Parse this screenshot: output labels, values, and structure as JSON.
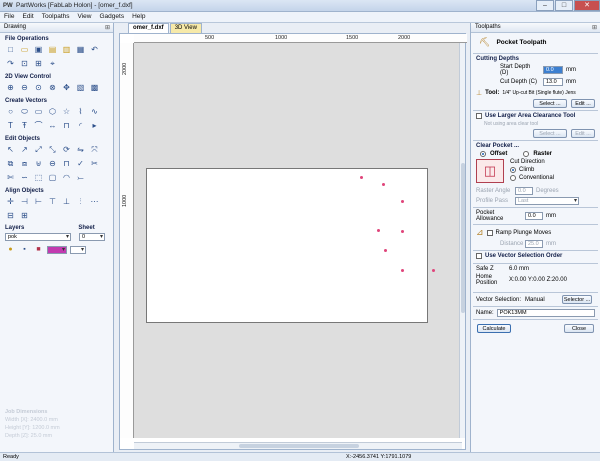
{
  "window": {
    "app_icon": "PW",
    "title": "PartWorks [FabLab Holon] - [omer_f.dxf]",
    "min": "–",
    "max": "□",
    "close": "✕"
  },
  "menu": [
    "File",
    "Edit",
    "Toolpaths",
    "View",
    "Gadgets",
    "Help"
  ],
  "left_panel": {
    "header": "Drawing",
    "pin": "⊞",
    "sections": [
      "File Operations",
      "2D View Control",
      "Create Vectors",
      "Edit Objects",
      "Align Objects"
    ],
    "layers_label": "Layers",
    "sheet_label": "Sheet",
    "layer_value": "pok",
    "sheet_value": "0",
    "job_dimensions": {
      "title": "Job Dimensions",
      "width": "Width  [X]: 2400.0 mm",
      "height": "Height [Y]: 1200.0 mm",
      "depth": "Depth  [Z]: 25.0 mm"
    }
  },
  "doc_tabs": [
    "omer_f.dxf",
    "3D View"
  ],
  "ruler": {
    "h": [
      "500",
      "1000",
      "1500",
      "2000"
    ],
    "v": [
      "2000",
      "1000"
    ]
  },
  "right_panel": {
    "header": "Toolpaths",
    "pin": "⊞",
    "title": "Pocket Toolpath",
    "cutting_depths": "Cutting Depths",
    "start_depth_label": "Start Depth (D)",
    "start_depth": "0.0",
    "cut_depth_label": "Cut Depth (C)",
    "cut_depth": "13.0",
    "unit": "mm",
    "tool_label": "Tool:",
    "tool_value": "1/4\" Up-cut Bit (Single flute) Jens",
    "select_btn": "Select ...",
    "edit_btn": "Edit ...",
    "large_area": "Use Larger Area Clearance Tool",
    "not_using": "Not using area clear tool",
    "clear_pocket": "Clear Pocket ...",
    "offset": "Offset",
    "raster": "Raster",
    "cut_direction": "Cut Direction",
    "climb": "Climb",
    "conventional": "Conventional",
    "raster_angle_label": "Raster Angle",
    "raster_angle": "0.0",
    "degrees": "Degrees",
    "profile_pass_label": "Profile Pass",
    "profile_pass": "Last",
    "pocket_allowance_label": "Pocket Allowance",
    "pocket_allowance": "0.0",
    "ramp": "Ramp Plunge Moves",
    "distance_label": "Distance",
    "distance": "25.0",
    "use_vector": "Use Vector Selection Order",
    "safe_z": "Safe Z",
    "safe_z_val": "6.0 mm",
    "home_label": "Home Position",
    "home_val": "X:0.00 Y:0.00 Z:20.00",
    "vector_sel_label": "Vector Selection:",
    "vector_sel_val": "Manual",
    "selector_btn": "Selector ...",
    "name_label": "Name:",
    "name_val": "POK13MM",
    "calculate": "Calculate",
    "close": "Close"
  },
  "status": {
    "left": "Ready",
    "coords": "X:-2456.3741 Y:1791.1079"
  }
}
